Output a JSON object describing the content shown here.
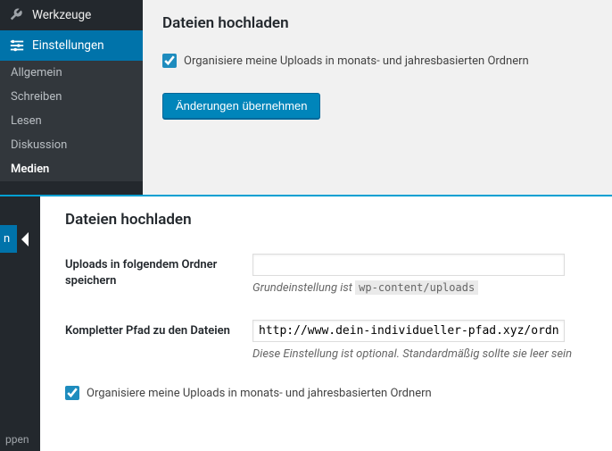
{
  "sidebar": {
    "tools": "Werkzeuge",
    "settings": "Einstellungen",
    "sub": [
      "Allgemein",
      "Schreiben",
      "Lesen",
      "Diskussion",
      "Medien"
    ]
  },
  "top": {
    "heading": "Dateien hochladen",
    "organize": "Organisiere meine Uploads in monats- und jahresbasierten Ordnern",
    "save": "Änderungen übernehmen"
  },
  "mini": {
    "tab": "n",
    "bottom": "ppen"
  },
  "bottom": {
    "heading": "Dateien hochladen",
    "field1_label": "Uploads in folgendem Ordner speichern",
    "field1_value": "",
    "field1_hint_prefix": "Grundeinstellung ist ",
    "field1_hint_code": "wp-content/uploads",
    "field2_label": "Kompletter Pfad zu den Dateien",
    "field2_value": "http://www.dein-individueller-pfad.xyz/ordn",
    "field2_hint": "Diese Einstellung ist optional. Standardmäßig sollte sie leer sein",
    "organize": "Organisiere meine Uploads in monats- und jahresbasierten Ordnern"
  }
}
